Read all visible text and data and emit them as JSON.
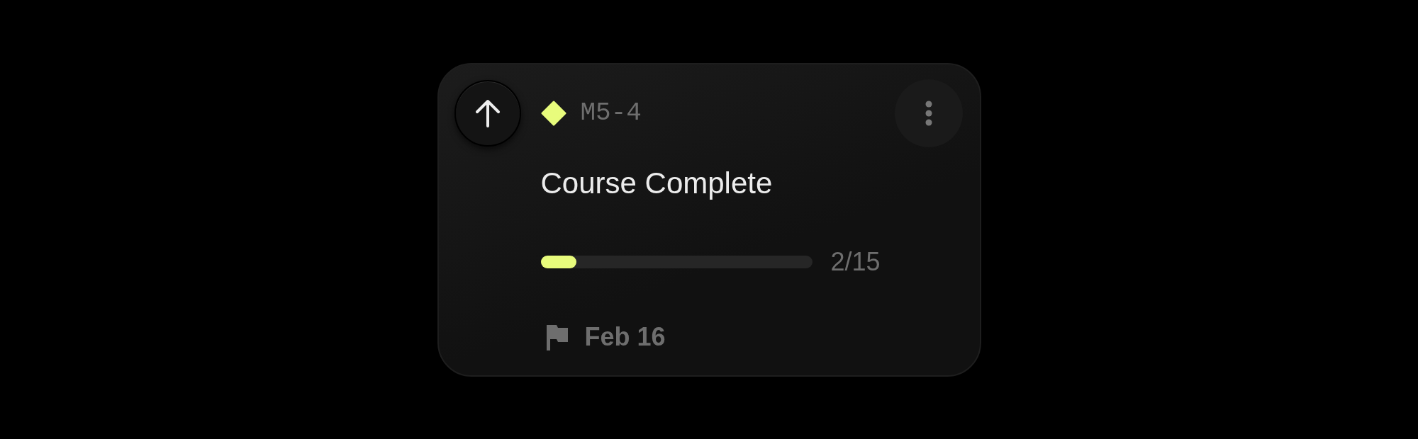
{
  "task": {
    "code": "M5-4",
    "title": "Course Complete",
    "progress": {
      "level": 0.133,
      "reading": "2/15"
    },
    "due_date": "Feb 16"
  }
}
